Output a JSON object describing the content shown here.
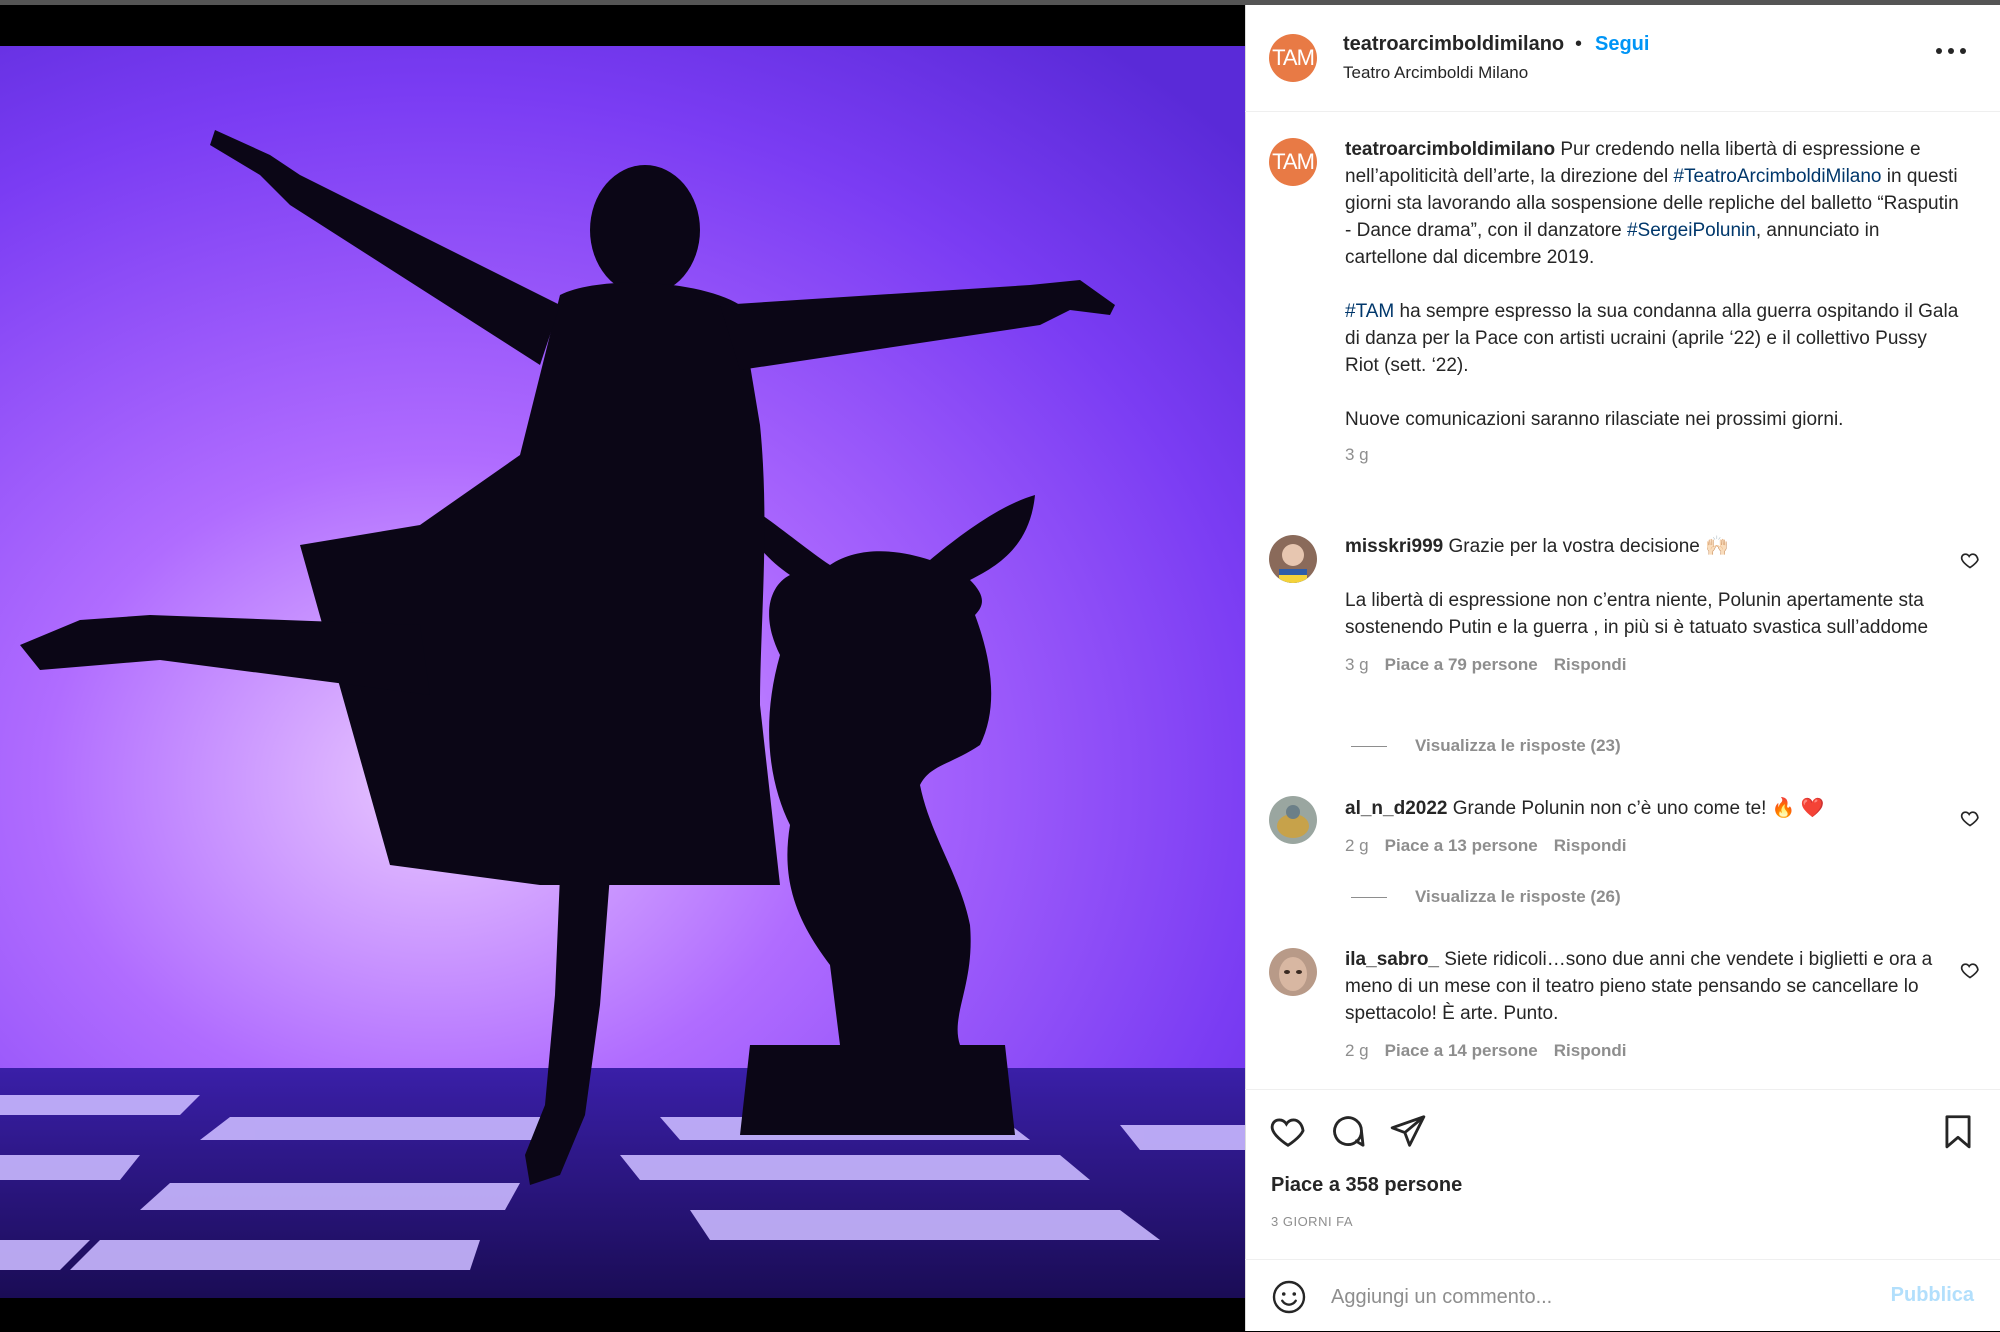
{
  "post": {
    "author": "teatroarcimboldimilano",
    "separator": "•",
    "follow_label": "Segui",
    "location": "Teatro Arcimboldi Milano",
    "avatar_text": "TAM",
    "more_icon": "more-horizontal-icon"
  },
  "caption": {
    "author": "teatroarcimboldimilano",
    "p1_a": " Pur credendo nella libertà di espressione e nell’apoliticità dell’arte, la direzione del ",
    "p1_tag1": "#TeatroArcimboldiMilano",
    "p1_b": " in questi giorni sta lavorando alla sospensione delle repliche del balletto “Rasputin - Dance drama”, con il danzatore ",
    "p1_tag2": "#SergeiPolunin",
    "p1_c": ", annunciato in cartellone dal dicembre 2019.",
    "p2_tag": "#TAM",
    "p2_text": " ha sempre espresso la sua condanna alla guerra ospitando il Gala di danza per la Pace con artisti ucraini (aprile ‘22) e il collettivo Pussy Riot (sett. ‘22).",
    "p3_text": "Nuove comunicazioni saranno rilasciate nei prossimi giorni.",
    "age": "3 g"
  },
  "comments": [
    {
      "user": "misskri999",
      "text_a": " Grazie per la vostra decisione 🙌🏻",
      "text_b": "La libertà di espressione non c’entra niente, Polunin apertamente sta sostenendo Putin e la guerra , in più si è tatuato svastica sull’addome",
      "age": "3 g",
      "likes": "Piace a 79 persone",
      "reply": "Rispondi",
      "view_replies": "Visualizza le risposte (23)"
    },
    {
      "user": "al_n_d2022",
      "text_a": " Grande Polunin non c’è uno come te! 🔥 ❤️",
      "age": "2 g",
      "likes": "Piace a 13 persone",
      "reply": "Rispondi",
      "view_replies": "Visualizza le risposte (26)"
    },
    {
      "user": "ila_sabro_",
      "text_a": " Siete ridicoli…sono due anni che vendete i biglietti e ora a meno di un mese con il teatro pieno state pensando se cancellare lo spettacolo! È arte. Punto.",
      "age": "2 g",
      "likes": "Piace a 14 persone",
      "reply": "Rispondi"
    }
  ],
  "actions": {
    "like_icon": "heart-icon",
    "comment_icon": "comment-icon",
    "share_icon": "send-icon",
    "save_icon": "bookmark-icon",
    "likes_text": "Piace a 358 persone",
    "time_text": "3 GIORNI FA"
  },
  "comment_bar": {
    "emoji_icon": "emoji-icon",
    "placeholder": "Aggiungi un commento...",
    "publish_label": "Pubblica"
  },
  "colors": {
    "link_blue": "#0095f6",
    "hashtag": "#00376b",
    "brand_avatar": "#e87a45",
    "stage_purple": "#8a4dff"
  }
}
